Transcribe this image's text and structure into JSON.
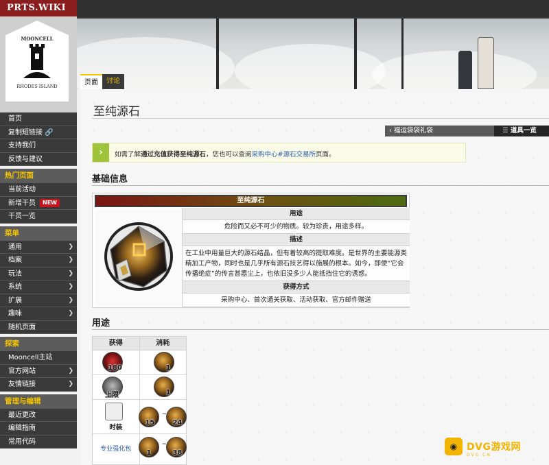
{
  "brand": "PRTS.WIKI",
  "logo": {
    "top_text": "MOONCELL",
    "bottom_text": "RHODES ISLAND"
  },
  "tabs": [
    {
      "label": "页面"
    },
    {
      "label": "讨论"
    }
  ],
  "sidebar": {
    "top_items": [
      {
        "label": "首页"
      },
      {
        "label": "复制短链接"
      },
      {
        "label": "支持我们"
      },
      {
        "label": "反馈与建议"
      }
    ],
    "sections": [
      {
        "title": "热门页面",
        "items": [
          {
            "label": "当前活动"
          },
          {
            "label": "新增干员",
            "badge": "NEW"
          },
          {
            "label": "干员一览"
          }
        ]
      },
      {
        "title": "菜单",
        "items": [
          {
            "label": "通用"
          },
          {
            "label": "档案"
          },
          {
            "label": "玩法"
          },
          {
            "label": "系统"
          },
          {
            "label": "扩展"
          },
          {
            "label": "趣味"
          },
          {
            "label": "随机页面"
          }
        ]
      },
      {
        "title": "探索",
        "items": [
          {
            "label": "Mooncell主站"
          },
          {
            "label": "官方网站"
          },
          {
            "label": "友情链接"
          }
        ]
      },
      {
        "title": "管理与编辑",
        "items": [
          {
            "label": "最近更改"
          },
          {
            "label": "编辑指南"
          },
          {
            "label": "常用代码"
          }
        ]
      }
    ]
  },
  "page": {
    "title": "至纯源石",
    "prev_nav": "福运袋袋礼袋",
    "list_nav": "道具一览",
    "notice": {
      "pre": "如需了解",
      "bold": "通过充值获得至纯源石",
      "mid": "，您也可以查阅",
      "link1": "采购中心#源石交易所",
      "post": "页面。"
    },
    "basic_info_heading": "基础信息",
    "usage_heading": "用途"
  },
  "infobox": {
    "title": "至纯源石",
    "use_h": "用途",
    "use_v": "危险而又必不可少的物质。较为珍贵，用途多样。",
    "desc_h": "描述",
    "desc_v": "在工业中用量巨大的源石结晶，但有着较高的提取难度。是世界的主要能源类精加工产物，同时也是几乎所有源石技艺得以施展的根本。如今，即使“它会传播绝症”的传言甚嚣尘上，也依旧没多少人能抵挡住它的诱惑。",
    "obtain_h": "获得方式",
    "obtain_v": "采购中心、首次通关获取、活动获取、官方邮件赠送"
  },
  "usage": {
    "headers": {
      "gain": "获得",
      "cost": "消耗"
    },
    "rows": [
      {
        "gain_num": "180",
        "cost": [
          "1"
        ]
      },
      {
        "gain_label": "上限",
        "cost": [
          "1"
        ]
      },
      {
        "gain_label": "时装",
        "cost": [
          "15",
          "24"
        ],
        "sep": "~"
      },
      {
        "gain_label": "专业强化包",
        "cost": [
          "1",
          "38"
        ],
        "sep": "~"
      }
    ]
  },
  "watermark": {
    "text": "DVG游戏网",
    "sub": "DVG.CN"
  },
  "colors": {
    "brand": "#8a1d1d",
    "accent": "#f5c400",
    "link": "#2a5db0",
    "notice": "#9fc43b"
  }
}
